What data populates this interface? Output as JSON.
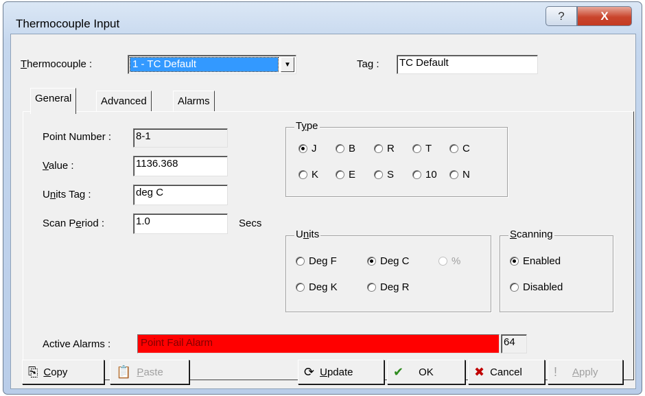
{
  "window": {
    "title": "Thermocouple Input",
    "help_label": "?",
    "close_label": "X"
  },
  "header": {
    "thermocouple_label": "hermocouple :",
    "thermocouple_accel": "T",
    "thermocouple_value": "1 - TC Default",
    "tag_label_pre": "Ta",
    "tag_accel": "g",
    "tag_label_post": " :",
    "tag_value": "TC Default"
  },
  "tabs": [
    {
      "label": "General",
      "active": true
    },
    {
      "label": "Advanced",
      "active": false
    },
    {
      "label": "Alarms",
      "active": false
    }
  ],
  "general": {
    "point_number_label": "Point Number :",
    "point_number_value": "8-1",
    "value_accel": "V",
    "value_label": "alue :",
    "value_value": "1136.368",
    "units_tag_pre": "U",
    "units_tag_accel": "n",
    "units_tag_post": "its Tag :",
    "units_tag_value": "deg C",
    "scan_period_pre": "Scan P",
    "scan_period_accel": "e",
    "scan_period_post": "riod :",
    "scan_period_value": "1.0",
    "scan_period_unit": "Secs",
    "active_alarms_label": "Active Alarms :",
    "active_alarms_value": "Point Fail Alarm",
    "active_alarms_code": "64"
  },
  "type_group": {
    "title_pre": "T",
    "title_accel": "y",
    "title_post": "pe",
    "options": [
      "J",
      "B",
      "R",
      "T",
      "C",
      "K",
      "E",
      "S",
      "10",
      "N"
    ],
    "selected": "J"
  },
  "units_group": {
    "title_pre": "U",
    "title_accel": "n",
    "title_post": "its",
    "options": [
      "Deg F",
      "Deg C",
      "%",
      "Deg K",
      "Deg R"
    ],
    "selected": "Deg C",
    "disabled": [
      "%"
    ]
  },
  "scanning_group": {
    "title_accel": "S",
    "title_post": "canning",
    "options": [
      "Enabled",
      "Disabled"
    ],
    "selected": "Enabled"
  },
  "buttons": {
    "copy_accel": "C",
    "copy_post": "opy",
    "paste_accel": "P",
    "paste_post": "aste",
    "update_accel": "U",
    "update_post": "pdate",
    "ok": "OK",
    "cancel": "Cancel",
    "apply_accel": "A",
    "apply_post": "pply"
  }
}
